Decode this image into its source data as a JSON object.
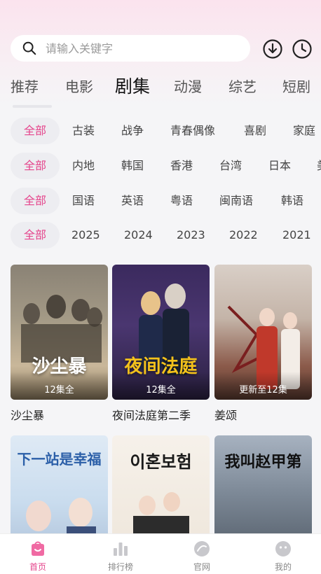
{
  "search": {
    "placeholder": "请输入关键字"
  },
  "tabs": [
    {
      "label": "推荐"
    },
    {
      "label": "电影"
    },
    {
      "label": "剧集",
      "active": true
    },
    {
      "label": "动漫"
    },
    {
      "label": "综艺"
    },
    {
      "label": "短剧"
    }
  ],
  "filters": {
    "genre": {
      "selected": "全部",
      "options": [
        "古装",
        "战争",
        "青春偶像",
        "喜剧",
        "家庭"
      ]
    },
    "region": {
      "selected": "全部",
      "options": [
        "内地",
        "韩国",
        "香港",
        "台湾",
        "日本",
        "美"
      ]
    },
    "language": {
      "selected": "全部",
      "options": [
        "国语",
        "英语",
        "粤语",
        "闽南语",
        "韩语"
      ]
    },
    "year": {
      "selected": "全部",
      "options": [
        "2025",
        "2024",
        "2023",
        "2022",
        "2021"
      ]
    }
  },
  "cards": [
    {
      "title": "沙尘暴",
      "badge": "12集全",
      "poster_text": "沙尘暴"
    },
    {
      "title": "夜间法庭第二季",
      "badge": "12集全",
      "poster_text": "夜间法庭"
    },
    {
      "title": "姜颂",
      "badge": "更新至12集",
      "poster_text": ""
    }
  ],
  "cards_row2": [
    {
      "poster_text": "下一站是幸福"
    },
    {
      "poster_text": "이혼보험"
    },
    {
      "poster_text": "我叫赵甲第"
    }
  ],
  "bottom_nav": [
    {
      "label": "首页",
      "icon": "home-icon",
      "active": true
    },
    {
      "label": "排行榜",
      "icon": "ranking-icon"
    },
    {
      "label": "官网",
      "icon": "website-icon"
    },
    {
      "label": "我的",
      "icon": "profile-icon"
    }
  ],
  "colors": {
    "accent": "#e5458c",
    "chip_bg": "#ededf1"
  }
}
